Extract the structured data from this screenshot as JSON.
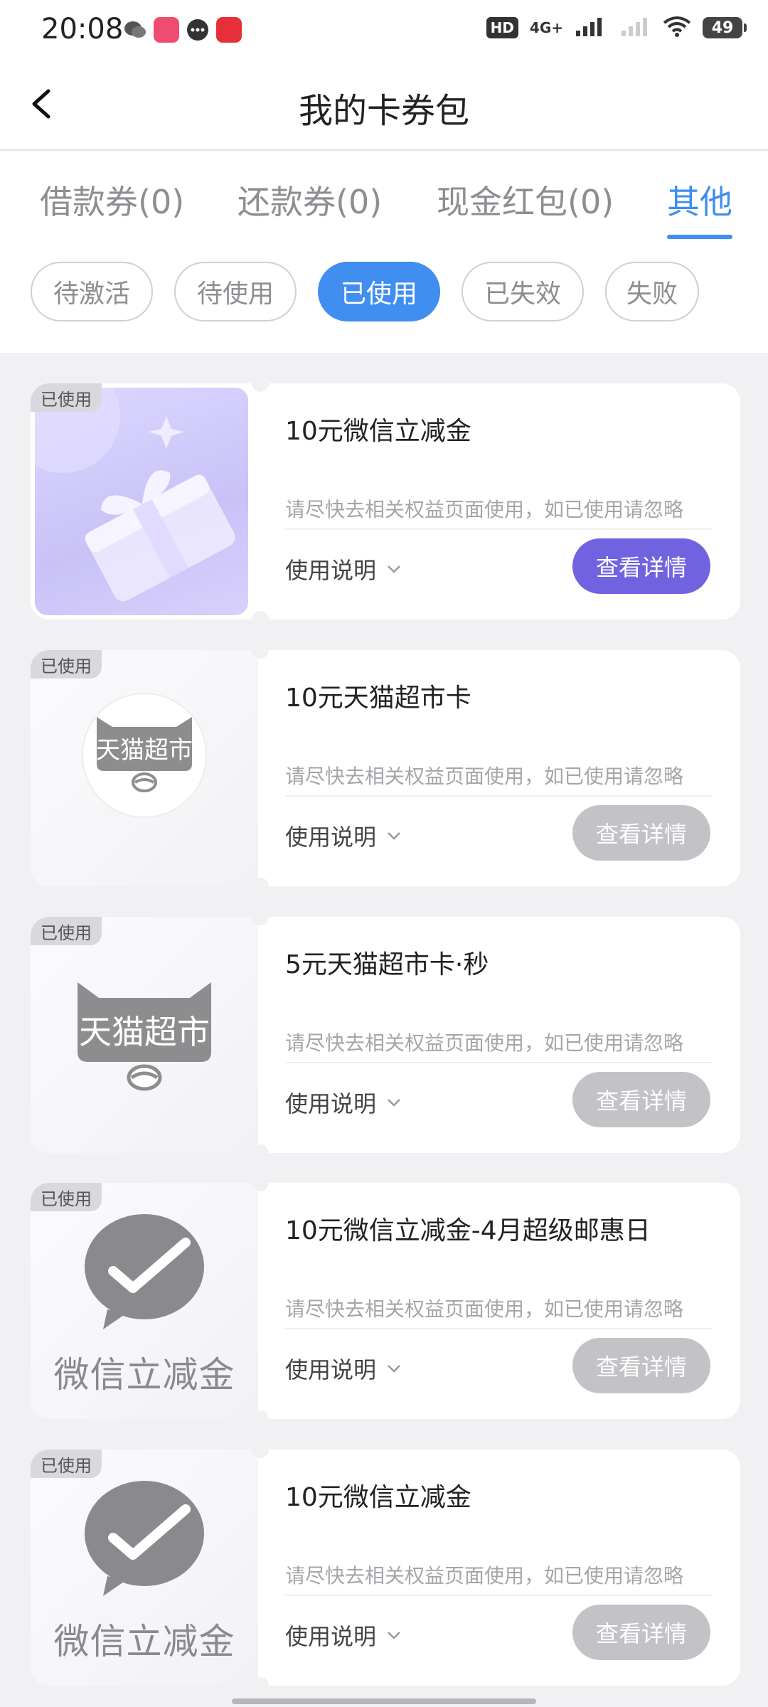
{
  "status_bar": {
    "time": "20:08",
    "hd": "HD",
    "network": "4G+",
    "battery": "49"
  },
  "header": {
    "title": "我的卡券包"
  },
  "tabs": [
    {
      "label": "借款券(0)"
    },
    {
      "label": "还款券(0)"
    },
    {
      "label": "现金红包(0)"
    },
    {
      "label": "其他"
    }
  ],
  "active_tab": "其他",
  "filters": [
    {
      "label": "待激活"
    },
    {
      "label": "待使用"
    },
    {
      "label": "已使用"
    },
    {
      "label": "已失效"
    },
    {
      "label": "失败"
    }
  ],
  "active_filter": "已使用",
  "cards": [
    {
      "badge": "已使用",
      "title": "10元微信立减金",
      "desc": "请尽快去相关权益页面使用，如已使用请忽略",
      "usage": "使用说明",
      "button": "查看详情",
      "image": "gift-box-icon",
      "button_state": "active"
    },
    {
      "badge": "已使用",
      "title": "10元天猫超市卡",
      "desc": "请尽快去相关权益页面使用，如已使用请忽略",
      "usage": "使用说明",
      "button": "查看详情",
      "image": "tmall-supermarket-logo",
      "logo_text": "天猫超市",
      "button_state": "disabled"
    },
    {
      "badge": "已使用",
      "title": "5元天猫超市卡·秒",
      "desc": "请尽快去相关权益页面使用，如已使用请忽略",
      "usage": "使用说明",
      "button": "查看详情",
      "image": "tmall-supermarket-logo",
      "logo_text": "天猫超市",
      "button_state": "disabled"
    },
    {
      "badge": "已使用",
      "title": "10元微信立减金-4月超级邮惠日",
      "desc": "请尽快去相关权益页面使用，如已使用请忽略",
      "usage": "使用说明",
      "button": "查看详情",
      "image": "wechat-pay-icon",
      "logo_text": "微信立减金",
      "button_state": "disabled"
    },
    {
      "badge": "已使用",
      "title": "10元微信立减金",
      "desc": "请尽快去相关权益页面使用，如已使用请忽略",
      "usage": "使用说明",
      "button": "查看详情",
      "image": "wechat-pay-icon",
      "logo_text": "微信立减金",
      "button_state": "disabled"
    }
  ],
  "colors": {
    "accent": "#3f8ef0",
    "primary_button": "#7163e0",
    "disabled_button": "#c3c3c7"
  }
}
